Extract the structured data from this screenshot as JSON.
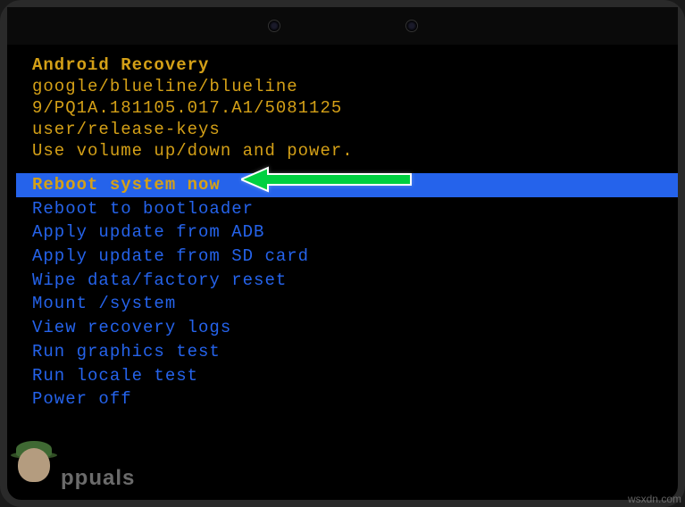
{
  "header": {
    "title": "Android Recovery",
    "device": "google/blueline/blueline",
    "build": "9/PQ1A.181105.017.A1/5081125",
    "keys": "user/release-keys",
    "instruction": "Use volume up/down and power."
  },
  "menu": {
    "selected_index": 0,
    "items": [
      "Reboot system now",
      "Reboot to bootloader",
      "Apply update from ADB",
      "Apply update from SD card",
      "Wipe data/factory reset",
      "Mount /system",
      "View recovery logs",
      "Run graphics test",
      "Run locale test",
      "Power off"
    ]
  },
  "watermark": {
    "left_text": "ppuals",
    "right_text": "wsxdn.com"
  }
}
